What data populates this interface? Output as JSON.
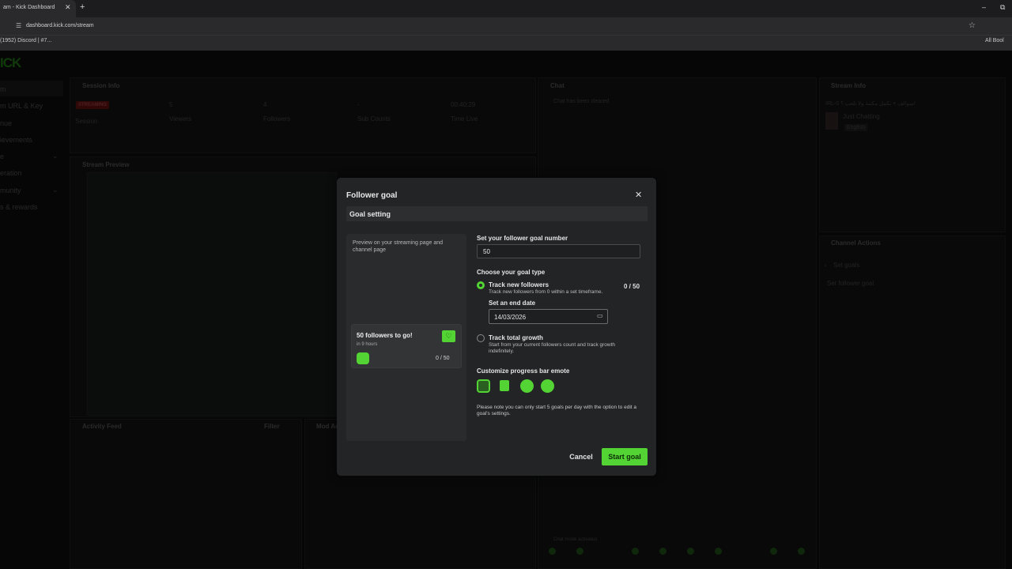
{
  "browser": {
    "tab_title": "am - Kick Dashboard",
    "tab_close": "✕",
    "new_tab": "+",
    "window_min": "–",
    "window_restore": "⧉",
    "url": "dashboard.kick.com/stream",
    "bookmark_discord": "(1952) Discord | #7...",
    "bookmark_all": "All Bool"
  },
  "sidebar": {
    "logo": "ICK",
    "items": [
      "m",
      "m URL & Key",
      "nue",
      "ievements",
      "e",
      "eration",
      "munity",
      "s & rewards"
    ]
  },
  "session": {
    "title": "Session Info",
    "badge": "STREAMING",
    "labels": [
      "Session",
      "Viewers",
      "Followers",
      "Sub Counts",
      "Time Live"
    ],
    "values": [
      "5",
      "4",
      "-",
      "00:40:29"
    ]
  },
  "preview": {
    "title": "Stream Preview"
  },
  "chat": {
    "title": "Chat",
    "empty": "Chat has been cleared",
    "emote_status": "Chat mode activated"
  },
  "stream_info": {
    "title": "Stream Info",
    "line1": "IRL-0 سوالف + تكمل مكتبة ولا تلعب ؟!",
    "category": "Just Chatting",
    "language": "English"
  },
  "channel_actions": {
    "title": "Channel Actions",
    "back": "Set goals",
    "item": "Set follower goal"
  },
  "activity": {
    "title": "Activity Feed",
    "filter": "Filter",
    "mod": "Mod Ac"
  },
  "modal": {
    "title": "Follower goal",
    "close": "✕",
    "tab": "Goal setting",
    "preview_text": "Preview on your streaming page and channel page",
    "card_title": "50 followers to go!",
    "card_sub": "in 9 hours",
    "card_count": "0 / 50",
    "goal_number_label": "Set your follower goal number",
    "goal_number_value": "50",
    "goal_type_label": "Choose your goal type",
    "opt_new_title": "Track new followers",
    "opt_new_desc": "Track new followers from 0 within a set timeframe.",
    "opt_new_count": "0 / 50",
    "end_date_label": "Set an end date",
    "end_date_value": "14/03/2026",
    "opt_total_title": "Track total growth",
    "opt_total_desc": "Start from your current followers count and track growth indefinitely.",
    "emote_label": "Customize progress bar emote",
    "note": "Please note you can only start 5 goals per day with the option to edit a goal's settings.",
    "cancel": "Cancel",
    "start": "Start goal"
  },
  "colors": {
    "accent": "#53d434",
    "bg": "#0b0c0c",
    "modal": "#232425"
  },
  "icons": [
    "tune-icon",
    "star-icon",
    "calendar-icon",
    "heart-icon",
    "close-icon",
    "popout-icon"
  ]
}
